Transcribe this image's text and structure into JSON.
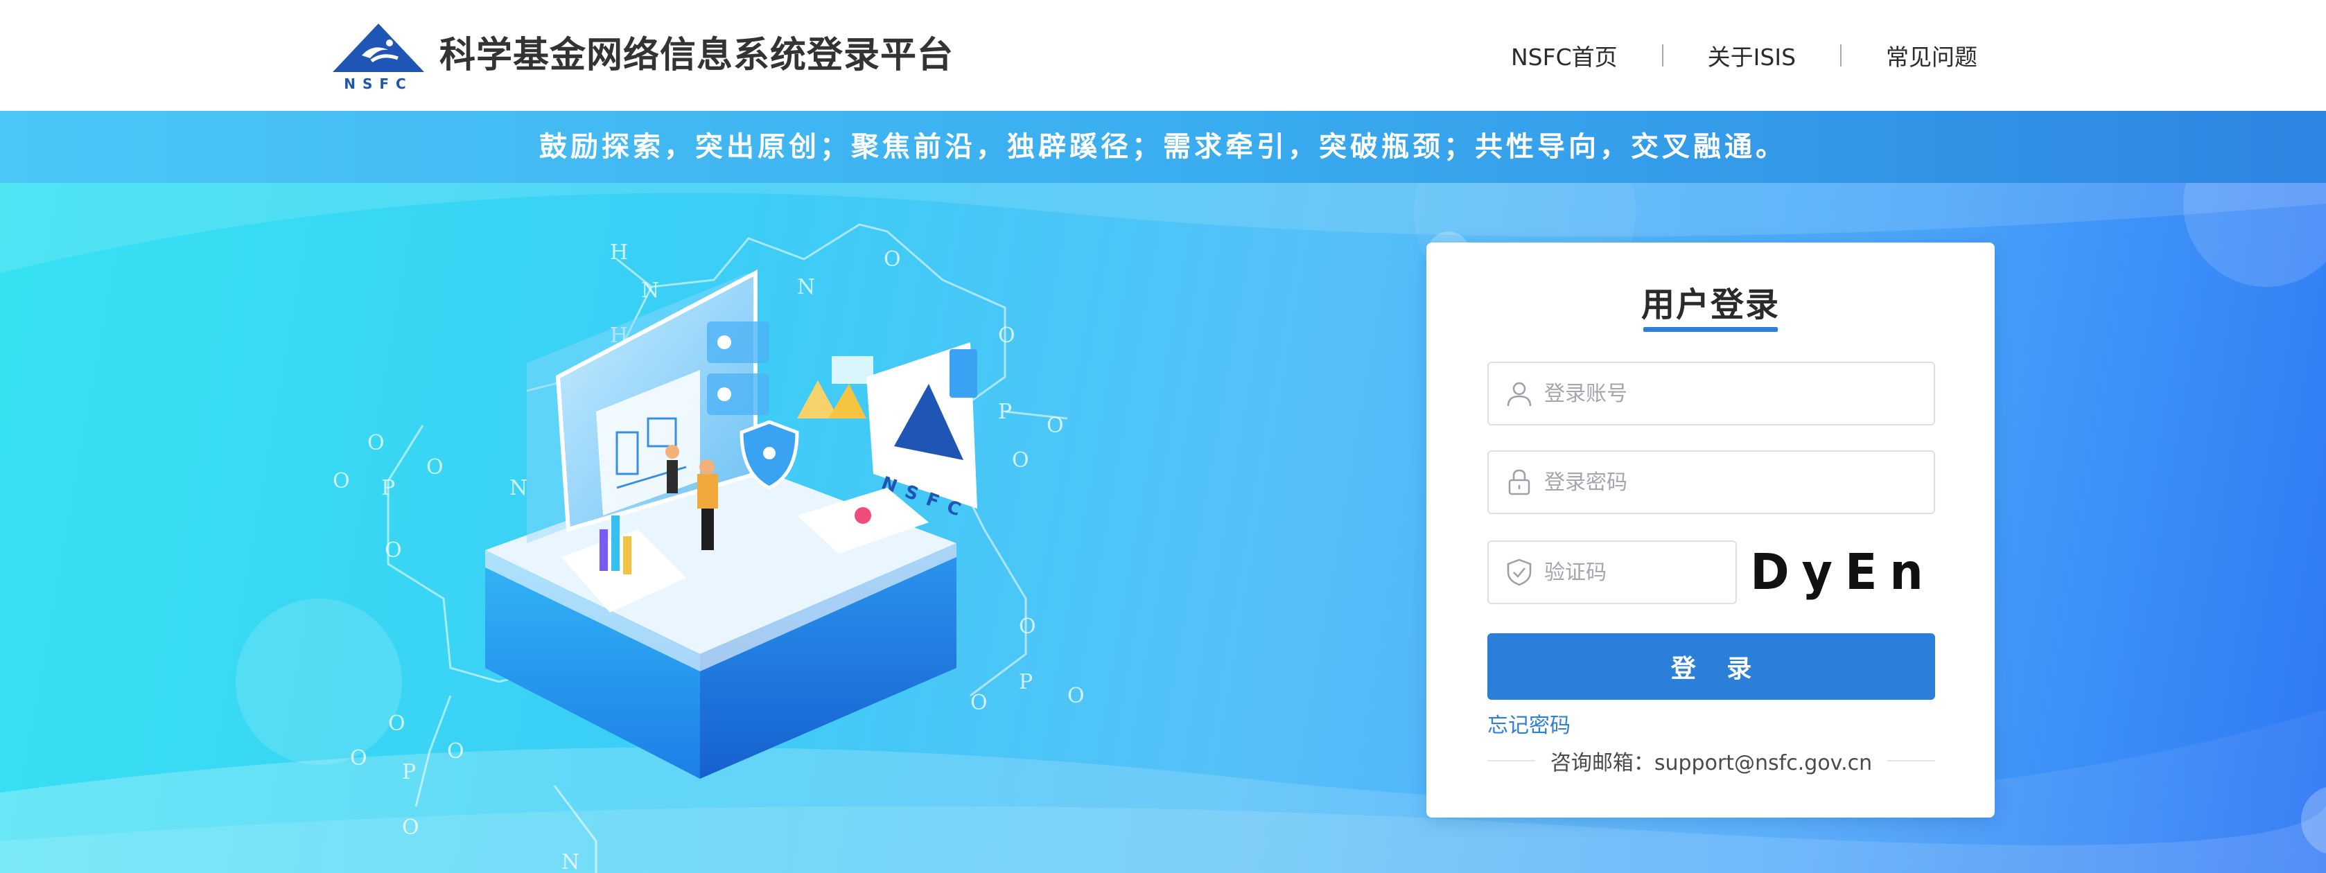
{
  "header": {
    "title": "科学基金网络信息系统登录平台",
    "logo_text": "NSFC",
    "nav": [
      {
        "label": "NSFC首页"
      },
      {
        "label": "关于ISIS"
      },
      {
        "label": "常见问题"
      }
    ]
  },
  "banner": {
    "slogan": "鼓励探索，突出原创；聚焦前沿，独辟蹊径；需求牵引，突破瓶颈；共性导向，交叉融通。"
  },
  "illustration": {
    "badge_text": "NSFC"
  },
  "login": {
    "title": "用户登录",
    "account_placeholder": "登录账号",
    "password_placeholder": "登录密码",
    "captcha_placeholder": "验证码",
    "captcha_code": "DyEn",
    "submit_label": "登 录",
    "forgot_label": "忘记密码",
    "support_text": "咨询邮箱：support@nsfc.gov.cn"
  },
  "colors": {
    "primary": "#2b7fd8",
    "hero_start": "#36e2f2",
    "hero_end": "#2f78f5",
    "header_text": "#333333"
  },
  "icons": [
    "nsfc-logo-icon",
    "user-icon",
    "lock-icon",
    "shield-check-icon"
  ]
}
